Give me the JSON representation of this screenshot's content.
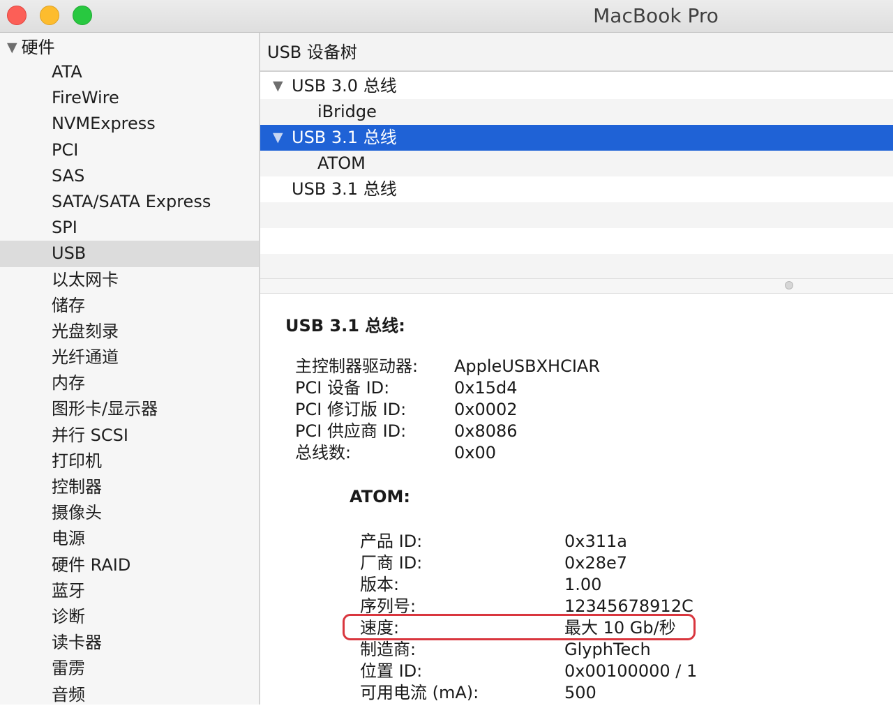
{
  "window": {
    "title": "MacBook Pro"
  },
  "sidebar": {
    "header": "硬件",
    "items": [
      "ATA",
      "FireWire",
      "NVMExpress",
      "PCI",
      "SAS",
      "SATA/SATA Express",
      "SPI",
      "USB",
      "以太网卡",
      "储存",
      "光盘刻录",
      "光纤通道",
      "内存",
      "图形卡/显示器",
      "并行 SCSI",
      "打印机",
      "控制器",
      "摄像头",
      "电源",
      "硬件 RAID",
      "蓝牙",
      "诊断",
      "读卡器",
      "雷雳",
      "音频"
    ],
    "selected": "USB"
  },
  "tree": {
    "header": "USB 设备树",
    "rows": [
      {
        "label": "USB 3.0 总线",
        "expanded": true
      },
      {
        "label": "iBridge"
      },
      {
        "label": "USB 3.1 总线",
        "expanded": true,
        "selected": true
      },
      {
        "label": "ATOM"
      },
      {
        "label": "USB 3.1 总线"
      }
    ]
  },
  "detail": {
    "title": "USB 3.1 总线:",
    "fields": [
      {
        "key": "主控制器驱动器:",
        "value": "AppleUSBXHCIAR"
      },
      {
        "key": "PCI 设备 ID:",
        "value": "0x15d4"
      },
      {
        "key": "PCI 修订版 ID:",
        "value": "0x0002"
      },
      {
        "key": "PCI 供应商 ID:",
        "value": "0x8086"
      },
      {
        "key": "总线数:",
        "value": "0x00"
      }
    ],
    "device": {
      "title": "ATOM:",
      "fields": [
        {
          "key": "产品 ID:",
          "value": "0x311a"
        },
        {
          "key": "厂商 ID:",
          "value": "0x28e7"
        },
        {
          "key": "版本:",
          "value": "1.00"
        },
        {
          "key": "序列号:",
          "value": "12345678912C"
        },
        {
          "key": "速度:",
          "value": "最大 10 Gb/秒"
        },
        {
          "key": "制造商:",
          "value": "GlyphTech"
        },
        {
          "key": "位置 ID:",
          "value": "0x00100000 / 1"
        },
        {
          "key": "可用电流 (mA):",
          "value": "500"
        }
      ]
    }
  },
  "colors": {
    "selection": "#1f62d6",
    "highlight_box": "#d9363e"
  },
  "icons": {
    "disclosure": "disclosure-triangle-icon"
  }
}
